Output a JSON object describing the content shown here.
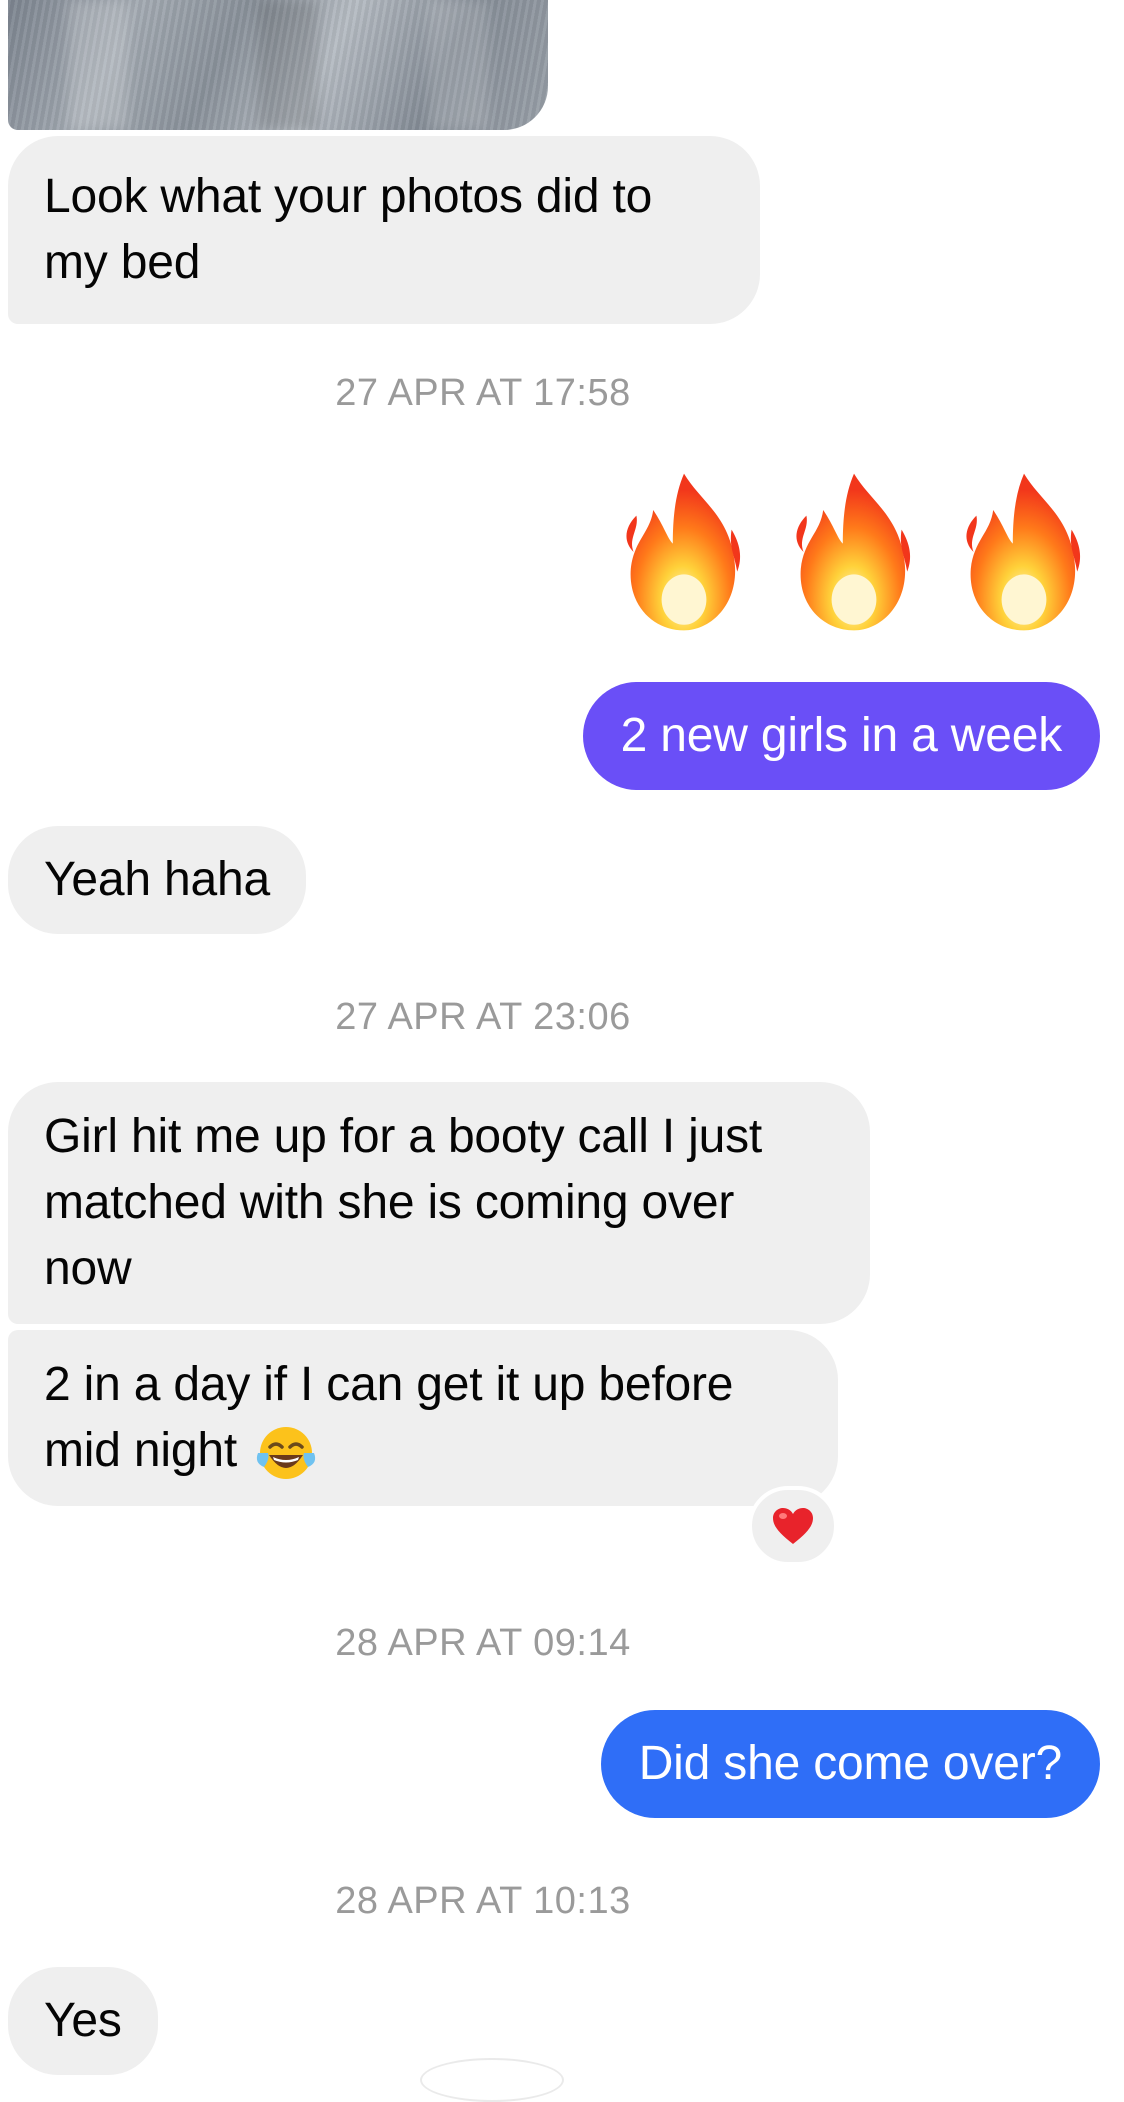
{
  "colors": {
    "incoming_bubble": "#efefef",
    "outgoing_purple": "#6a4ff7",
    "outgoing_blue": "#2f6ef7",
    "timestamp": "#9a9a9a"
  },
  "messages": [
    {
      "id": "m1",
      "direction": "incoming",
      "text": "Look what your photos did to my bed"
    },
    {
      "id": "t1",
      "type": "timestamp",
      "text": "27 APR AT 17:58"
    },
    {
      "id": "m2",
      "direction": "outgoing",
      "type": "emoji",
      "icons": [
        "fire-emoji",
        "fire-emoji",
        "fire-emoji"
      ]
    },
    {
      "id": "m3",
      "direction": "outgoing",
      "text": "2 new girls in a week"
    },
    {
      "id": "m4",
      "direction": "incoming",
      "text": "Yeah haha"
    },
    {
      "id": "t2",
      "type": "timestamp",
      "text": "27 APR AT 23:06"
    },
    {
      "id": "m5",
      "direction": "incoming",
      "text": "Girl hit me up for a booty call I just matched with she is coming over now"
    },
    {
      "id": "m6",
      "direction": "incoming",
      "text": "2 in a day if I can get it up before mid night",
      "trailing_icon": "tears-of-joy-emoji",
      "reaction_icon": "red-heart-emoji"
    },
    {
      "id": "t3",
      "type": "timestamp",
      "text": "28 APR AT 09:14"
    },
    {
      "id": "m7",
      "direction": "outgoing",
      "text": "Did she come over?"
    },
    {
      "id": "t4",
      "type": "timestamp",
      "text": "28 APR AT 10:13"
    },
    {
      "id": "m8",
      "direction": "incoming",
      "text": "Yes"
    }
  ]
}
